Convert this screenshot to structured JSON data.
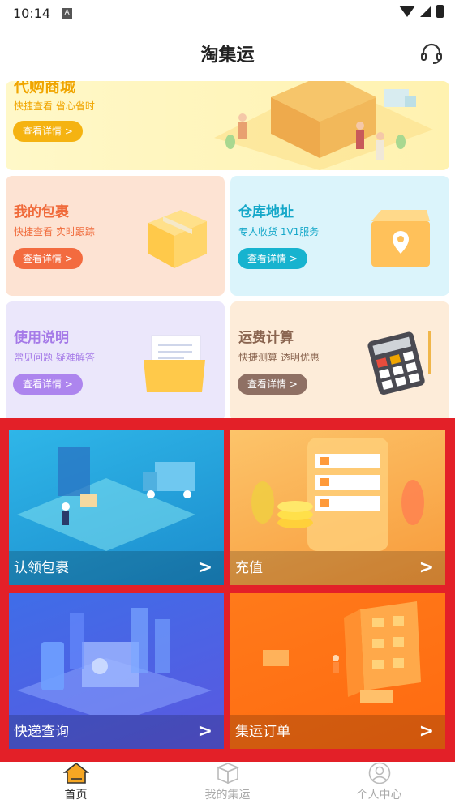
{
  "status_bar": {
    "time": "10:14",
    "indicator": "A"
  },
  "header": {
    "title": "淘集运",
    "action_icon": "headset-icon"
  },
  "banner": {
    "title": "代购商城",
    "subtitle": "快捷查看 省心省时",
    "button": "查看详情 >"
  },
  "cards": [
    {
      "title": "我的包裹",
      "subtitle": "快捷查看 实时跟踪",
      "button": "查看详情 >",
      "icon": "package-icon"
    },
    {
      "title": "仓库地址",
      "subtitle": "专人收货 1V1服务",
      "button": "查看详情 >",
      "icon": "location-box-icon"
    },
    {
      "title": "使用说明",
      "subtitle": "常见问题 疑难解答",
      "button": "查看详情 >",
      "icon": "folder-icon"
    },
    {
      "title": "运费计算",
      "subtitle": "快捷测算 透明优惠",
      "button": "查看详情 >",
      "icon": "calculator-icon"
    }
  ],
  "tiles": [
    {
      "label": "认领包裹",
      "arrow": ">"
    },
    {
      "label": "充值",
      "arrow": ">"
    },
    {
      "label": "快递查询",
      "arrow": ">"
    },
    {
      "label": "集运订单",
      "arrow": ">"
    }
  ],
  "bottom_nav": [
    {
      "label": "首页",
      "icon": "home-icon",
      "active": true
    },
    {
      "label": "我的集运",
      "icon": "box-icon",
      "active": false
    },
    {
      "label": "个人中心",
      "icon": "user-icon",
      "active": false
    }
  ],
  "colors": {
    "highlight": "#e32028",
    "home_active": "#f5a623"
  }
}
